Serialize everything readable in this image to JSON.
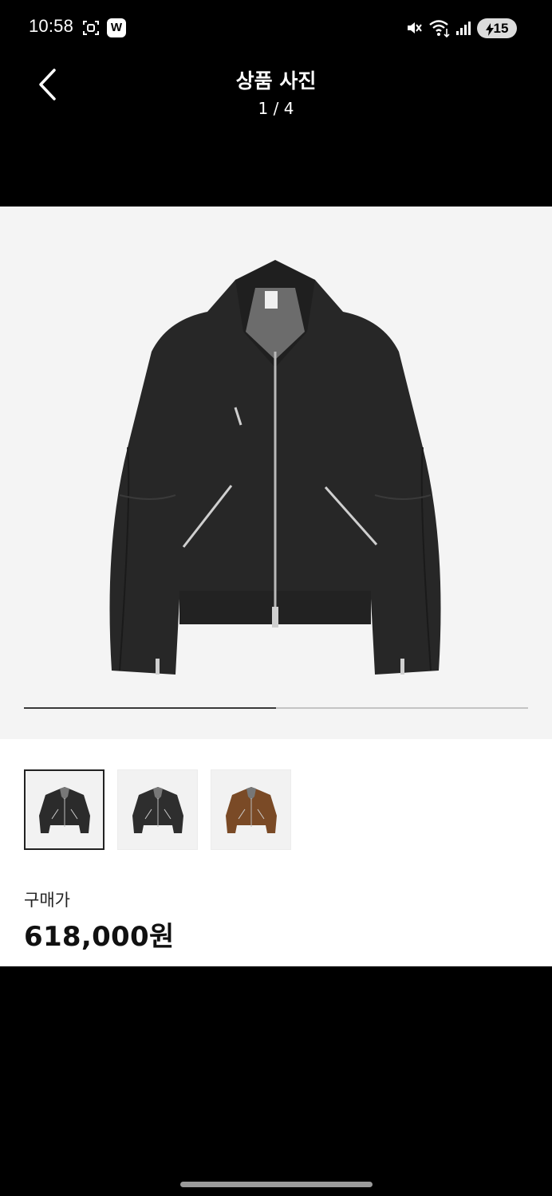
{
  "status_bar": {
    "time": "10:58",
    "app_badge": "W",
    "battery": "15",
    "icons": [
      "screen-record-icon",
      "w-app-icon",
      "mute-icon",
      "wifi-icon",
      "signal-icon",
      "battery-icon"
    ]
  },
  "header": {
    "title": "상품 사진",
    "counter": "1 / 4",
    "back_icon": "chevron-left-icon"
  },
  "gallery": {
    "current_index": 1,
    "total": 4,
    "progress_fraction": 0.5,
    "main_image": "black-suede-jacket",
    "thumbnails": [
      {
        "color": "#2b2b2b",
        "selected": true,
        "icon": "jacket-black-front"
      },
      {
        "color": "#2e2e2e",
        "selected": false,
        "icon": "jacket-black-front"
      },
      {
        "color": "#7a4a26",
        "selected": false,
        "icon": "jacket-brown-front"
      }
    ]
  },
  "pricing": {
    "label": "구매가",
    "price": "618,000원"
  },
  "colors": {
    "background": "#000000",
    "stage": "#f4f4f4",
    "panel": "#ffffff",
    "text_dark": "#111111"
  }
}
